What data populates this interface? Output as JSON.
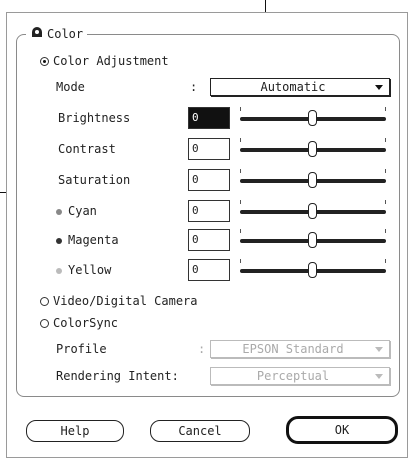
{
  "group": {
    "title": "Color",
    "icon": "color-wheel-icon"
  },
  "color_adjustment": {
    "label": "Color Adjustment",
    "mode": {
      "label": "Mode",
      "colon": ":",
      "value": "Automatic"
    },
    "sliders": [
      {
        "name": "brightness",
        "label": "Brightness",
        "value": "0",
        "level": 0.5
      },
      {
        "name": "contrast",
        "label": "Contrast",
        "value": "0",
        "level": 0.5
      },
      {
        "name": "saturation",
        "label": "Saturation",
        "value": "0",
        "level": 0.5
      },
      {
        "name": "cyan",
        "label": "Cyan",
        "value": "0",
        "level": 0.5,
        "dot_color": "#888888"
      },
      {
        "name": "magenta",
        "label": "Magenta",
        "value": "0",
        "level": 0.5,
        "dot_color": "#333333"
      },
      {
        "name": "yellow",
        "label": "Yellow",
        "value": "0",
        "level": 0.5,
        "dot_color": "#bbbbbb"
      }
    ]
  },
  "video_option": {
    "label": "Video/Digital Camera"
  },
  "colorsync": {
    "label": "ColorSync",
    "profile": {
      "label": "Profile",
      "colon": ":",
      "value": "EPSON Standard"
    },
    "rendering": {
      "label": "Rendering Intent:",
      "value": "Perceptual"
    }
  },
  "buttons": {
    "help": "Help",
    "cancel": "Cancel",
    "ok": "OK"
  }
}
